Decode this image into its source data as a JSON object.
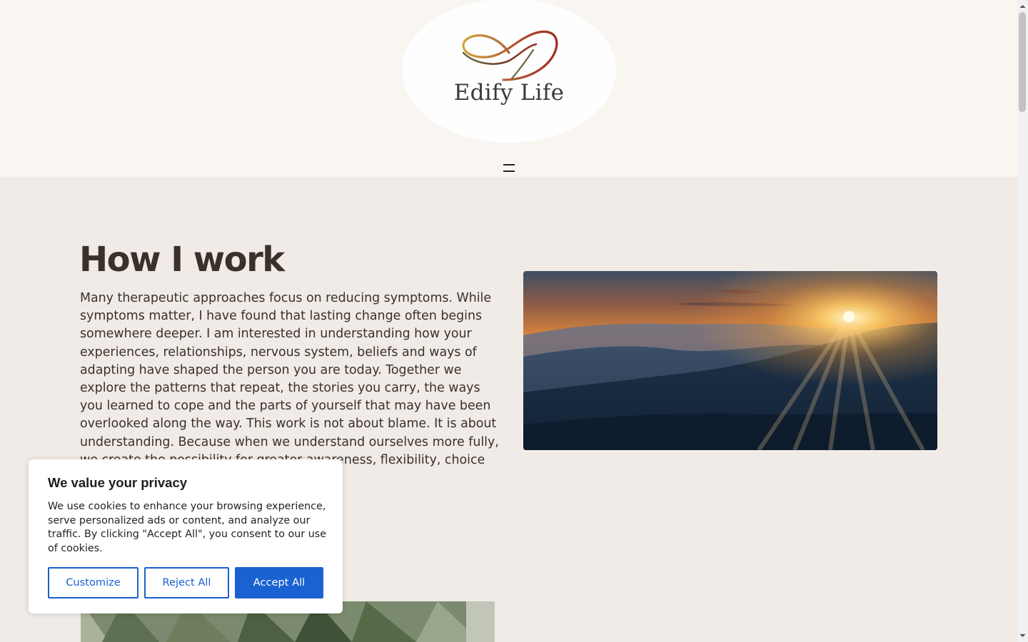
{
  "header": {
    "logo_text": "Edify Life",
    "menu_label": ""
  },
  "colors": {
    "header_bg": "#f9f5f0",
    "page_bg": "#f0ebe6",
    "text": "#3b302b",
    "accent": "#1a61d1",
    "logo_gold": "#c99a3a",
    "logo_red": "#9e2a24",
    "logo_green": "#5e6b3c"
  },
  "main": {
    "title": "How I work",
    "body": "Many therapeutic approaches focus on reducing symptoms. While symptoms matter, I have found that lasting change often begins somewhere deeper. I am interested in understanding how your experiences, relationships, nervous system, beliefs and ways of adapting have shaped the person you are today. Together we explore the patterns that repeat, the stories you carry, the ways you learned to cope and the parts of yourself that may have been overlooked along the way. This work is not about blame. It is about understanding. Because when we understand ourselves more fully, we create the possibility for greater awareness, flexibility, choice and"
  },
  "images": {
    "hero_image_icon": "sunset-mountains-image",
    "lower_image_icon": "forest-trees-image"
  },
  "cookie_banner": {
    "title": "We value your privacy",
    "text": "We use cookies to enhance your browsing experience, serve personalized ads or content, and analyze our traffic. By clicking \"Accept All\", you consent to our use of cookies.",
    "customize_label": "Customize",
    "reject_label": "Reject All",
    "accept_label": "Accept All"
  }
}
